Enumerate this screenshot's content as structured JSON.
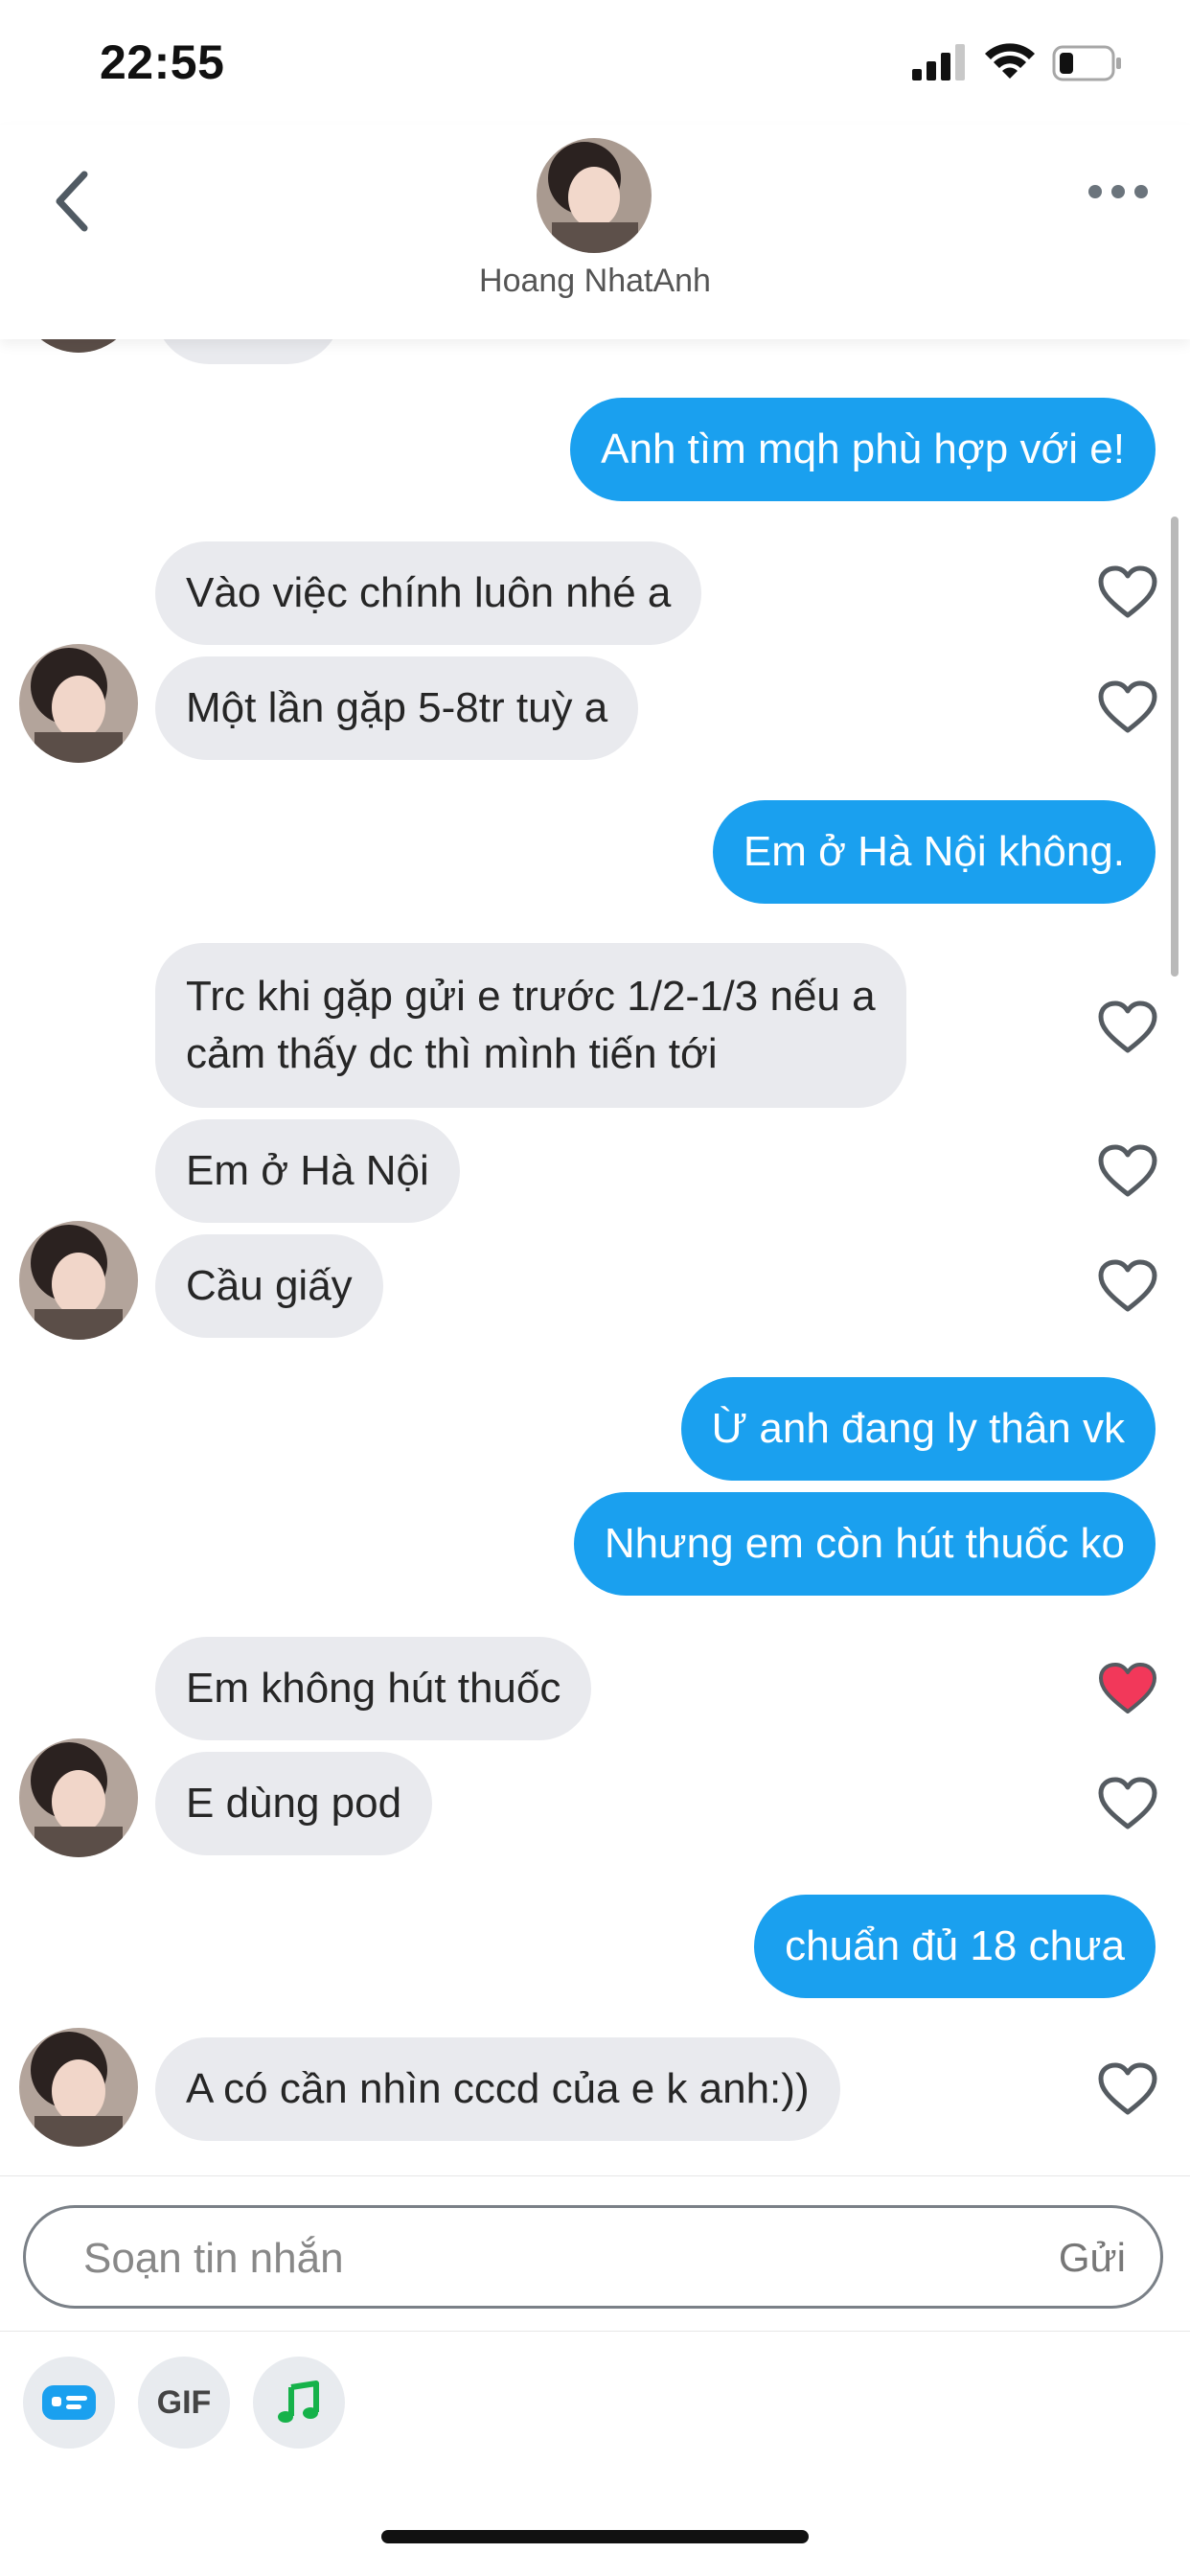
{
  "status_bar": {
    "time": "22:55"
  },
  "header": {
    "contact_name": "Hoang NhatAnh"
  },
  "messages": [
    {
      "from": "me",
      "text": "Anh tìm mqh phù hợp với e!"
    },
    {
      "from": "them",
      "text": "Vào việc chính luôn nhé a",
      "liked": false
    },
    {
      "from": "them",
      "text": "Một lần gặp 5-8tr tuỳ a",
      "liked": false
    },
    {
      "from": "me",
      "text": "Em ở Hà Nội không."
    },
    {
      "from": "them",
      "line1": "Trc khi gặp gửi e trước 1/2-1/3 nếu a",
      "line2": "cảm thấy dc thì mình tiến tới",
      "liked": false
    },
    {
      "from": "them",
      "text": "Em ở Hà Nội",
      "liked": false
    },
    {
      "from": "them",
      "text": "Cầu giấy",
      "liked": false
    },
    {
      "from": "me",
      "text": "Ừ anh đang ly thân vk"
    },
    {
      "from": "me",
      "text": "Nhưng em còn hút thuốc ko"
    },
    {
      "from": "them",
      "text": "Em không hút thuốc",
      "liked": true
    },
    {
      "from": "them",
      "text": "E dùng pod",
      "liked": false
    },
    {
      "from": "me",
      "text": "chuẩn đủ 18 chưa"
    },
    {
      "from": "them",
      "text": "A có cần nhìn cccd của e k anh:))",
      "liked": false
    }
  ],
  "composer": {
    "placeholder": "Soạn tin nhắn",
    "send_label": "Gửi"
  },
  "toolbar": {
    "gif_label": "GIF"
  },
  "colors": {
    "outgoing_bubble": "#1aa0ef",
    "incoming_bubble": "#e9eaee",
    "liked_heart": "#f2385a"
  }
}
